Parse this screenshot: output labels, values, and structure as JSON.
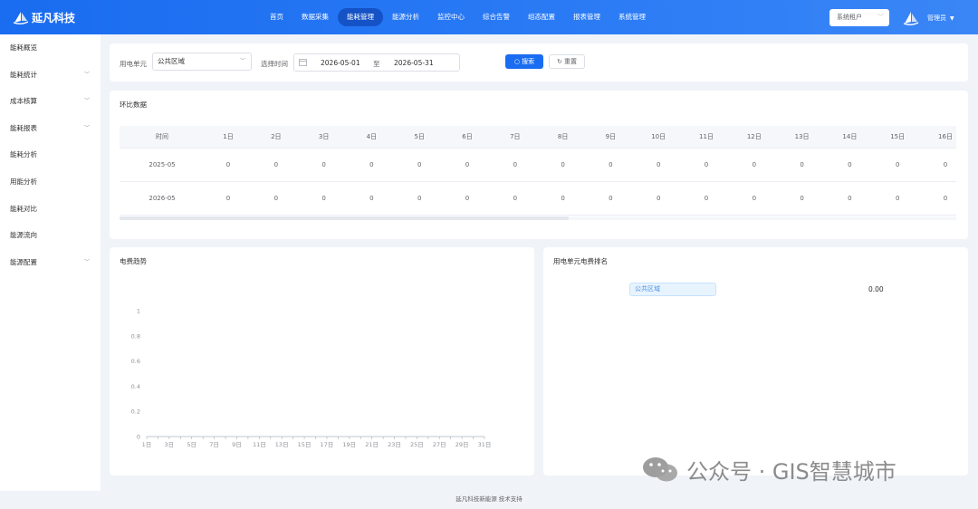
{
  "header": {
    "brand": "延凡科技",
    "nav": [
      {
        "label": "首页",
        "active": false
      },
      {
        "label": "数据采集",
        "active": false
      },
      {
        "label": "能耗管理",
        "active": true
      },
      {
        "label": "能源分析",
        "active": false
      },
      {
        "label": "监控中心",
        "active": false
      },
      {
        "label": "综合告警",
        "active": false
      },
      {
        "label": "组态配置",
        "active": false
      },
      {
        "label": "报表管理",
        "active": false
      },
      {
        "label": "系统管理",
        "active": false
      }
    ],
    "tenant_label": "系统租户",
    "user_name": "管理员"
  },
  "sidebar": {
    "items": [
      {
        "label": "能耗概览",
        "expandable": false
      },
      {
        "label": "能耗统计",
        "expandable": true
      },
      {
        "label": "成本核算",
        "expandable": true
      },
      {
        "label": "能耗报表",
        "expandable": true
      },
      {
        "label": "能耗分析",
        "expandable": false
      },
      {
        "label": "用能分析",
        "expandable": false
      },
      {
        "label": "能耗对比",
        "expandable": false
      },
      {
        "label": "能源流向",
        "expandable": false
      },
      {
        "label": "能源配置",
        "expandable": true
      }
    ]
  },
  "filter": {
    "unit_label": "用电单元",
    "unit_value": "公共区域",
    "time_label": "选择时间",
    "date_start": "2026-05-01",
    "date_separator": "至",
    "date_end": "2026-05-31",
    "search_label": "搜索",
    "reset_label": "重置"
  },
  "compare": {
    "title": "环比数据",
    "columns": [
      "时间",
      "1日",
      "2日",
      "3日",
      "4日",
      "5日",
      "6日",
      "7日",
      "8日",
      "9日",
      "10日",
      "11日",
      "12日",
      "13日",
      "14日",
      "15日",
      "16日"
    ],
    "rows": [
      {
        "time": "2025-05",
        "values": [
          "0",
          "0",
          "0",
          "0",
          "0",
          "0",
          "0",
          "0",
          "0",
          "0",
          "0",
          "0",
          "0",
          "0",
          "0",
          "0"
        ]
      },
      {
        "time": "2026-05",
        "values": [
          "0",
          "0",
          "0",
          "0",
          "0",
          "0",
          "0",
          "0",
          "0",
          "0",
          "0",
          "0",
          "0",
          "0",
          "0",
          "0"
        ]
      }
    ]
  },
  "trend": {
    "title": "电费趋势"
  },
  "chart_data": {
    "type": "line",
    "title": "电费趋势",
    "xlabel": "",
    "ylabel": "",
    "ylim": [
      0,
      1
    ],
    "yticks": [
      "0",
      "0.2",
      "0.4",
      "0.6",
      "0.8",
      "1"
    ],
    "xticks": [
      "1日",
      "3日",
      "5日",
      "7日",
      "9日",
      "11日",
      "13日",
      "15日",
      "17日",
      "19日",
      "21日",
      "23日",
      "25日",
      "27日",
      "29日",
      "31日"
    ],
    "categories_count": 31,
    "series": [],
    "grid": false,
    "legend": "none"
  },
  "ranking": {
    "title": "用电单元电费排名",
    "items": [
      {
        "name": "公共区域",
        "value": "0.00"
      }
    ]
  },
  "footer": {
    "text": "延凡科技新能源 技术支持"
  },
  "watermark": {
    "text": "公众号 · GIS智慧城市"
  },
  "colors": {
    "primary": "#1a6cf0",
    "nav_active": "#1552c6",
    "tag_bg": "#e8f4fd",
    "tag_text": "#4a8fe7"
  }
}
